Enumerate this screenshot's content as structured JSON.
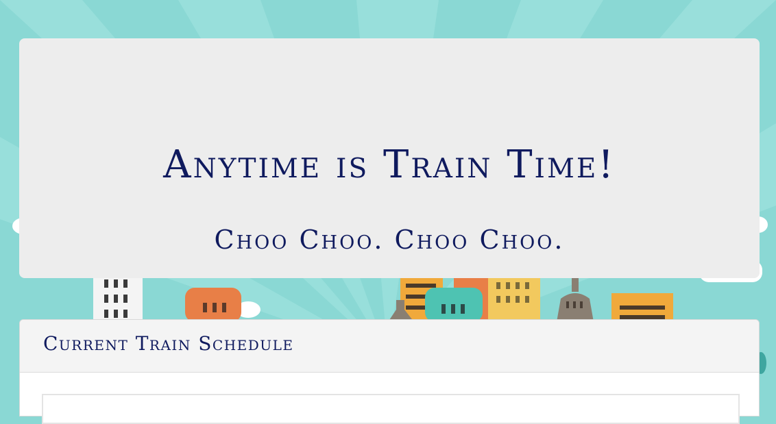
{
  "jumbotron": {
    "title": "Anytime is Train Time!",
    "subtitle": "Choo Choo. Choo Choo."
  },
  "schedule_panel": {
    "title": "Current Train Schedule"
  },
  "colors": {
    "background": "#8ad8d4",
    "text": "#0f1a5e",
    "jumbotron_bg": "#ededed"
  }
}
